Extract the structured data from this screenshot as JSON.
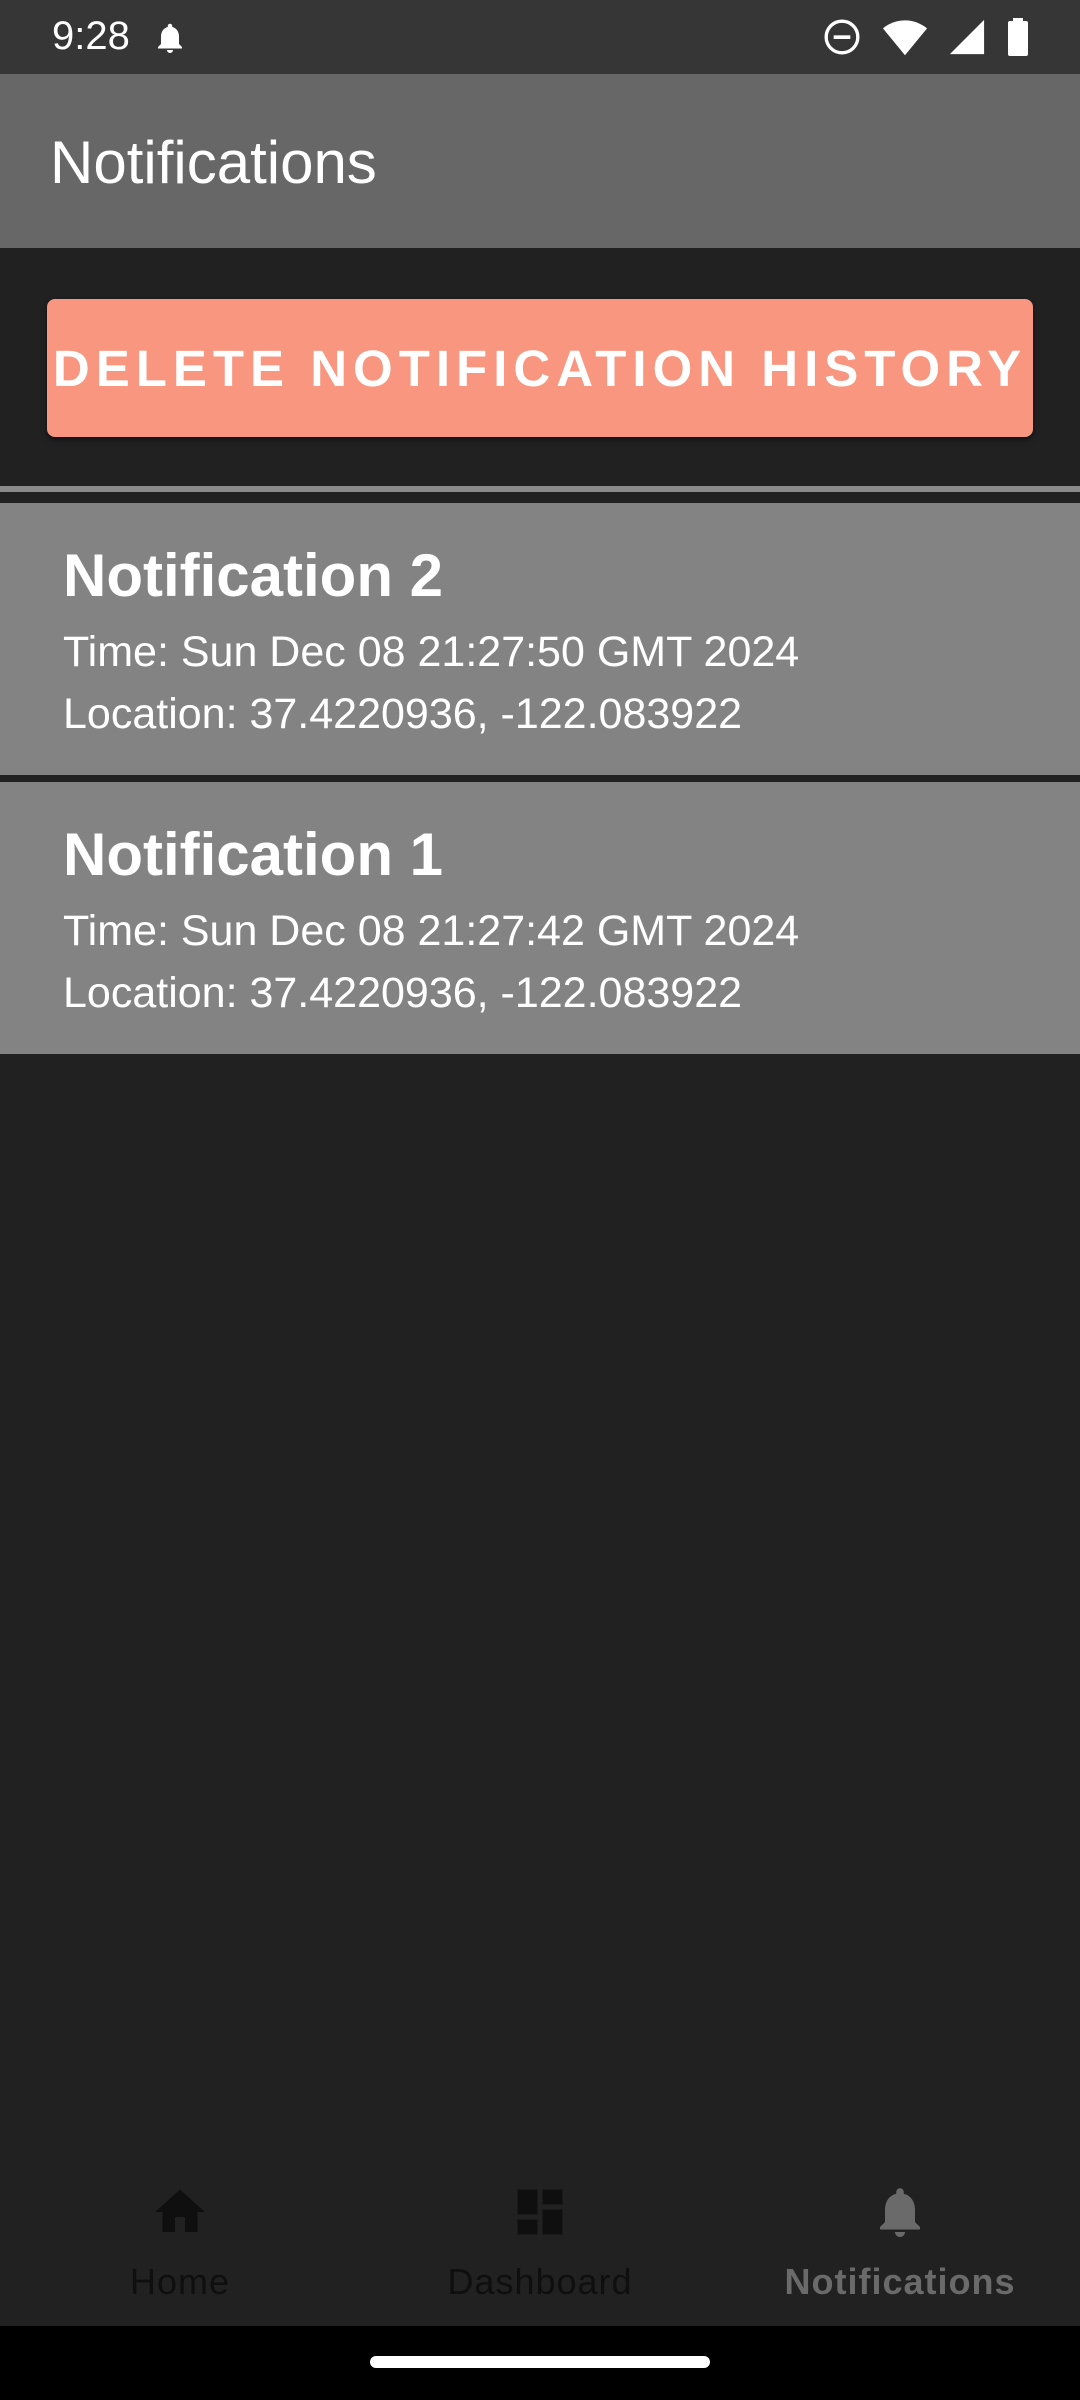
{
  "status_bar": {
    "time": "9:28",
    "icons": [
      "notification-bell-icon",
      "do-not-disturb-icon",
      "wifi-icon",
      "cell-signal-icon",
      "battery-icon"
    ]
  },
  "app_bar": {
    "title": "Notifications"
  },
  "actions": {
    "delete_label": "DELETE NOTIFICATION HISTORY"
  },
  "notifications": [
    {
      "title": "Notification 2",
      "time": "Time: Sun Dec 08 21:27:50 GMT 2024",
      "location": "Location: 37.4220936, -122.083922"
    },
    {
      "title": "Notification 1",
      "time": "Time: Sun Dec 08 21:27:42 GMT 2024",
      "location": "Location: 37.4220936, -122.083922"
    }
  ],
  "bottom_nav": {
    "items": [
      {
        "label": "Home",
        "icon": "home-icon",
        "active": false
      },
      {
        "label": "Dashboard",
        "icon": "dashboard-icon",
        "active": false
      },
      {
        "label": "Notifications",
        "icon": "bell-icon",
        "active": true
      }
    ]
  },
  "colors": {
    "background": "#212121",
    "status_bar": "#363636",
    "app_bar": "#676767",
    "accent_button": "#f8967f",
    "card": "#838383",
    "nav_active": "#6a6a6a",
    "nav_inactive": "#0f0f0f"
  }
}
